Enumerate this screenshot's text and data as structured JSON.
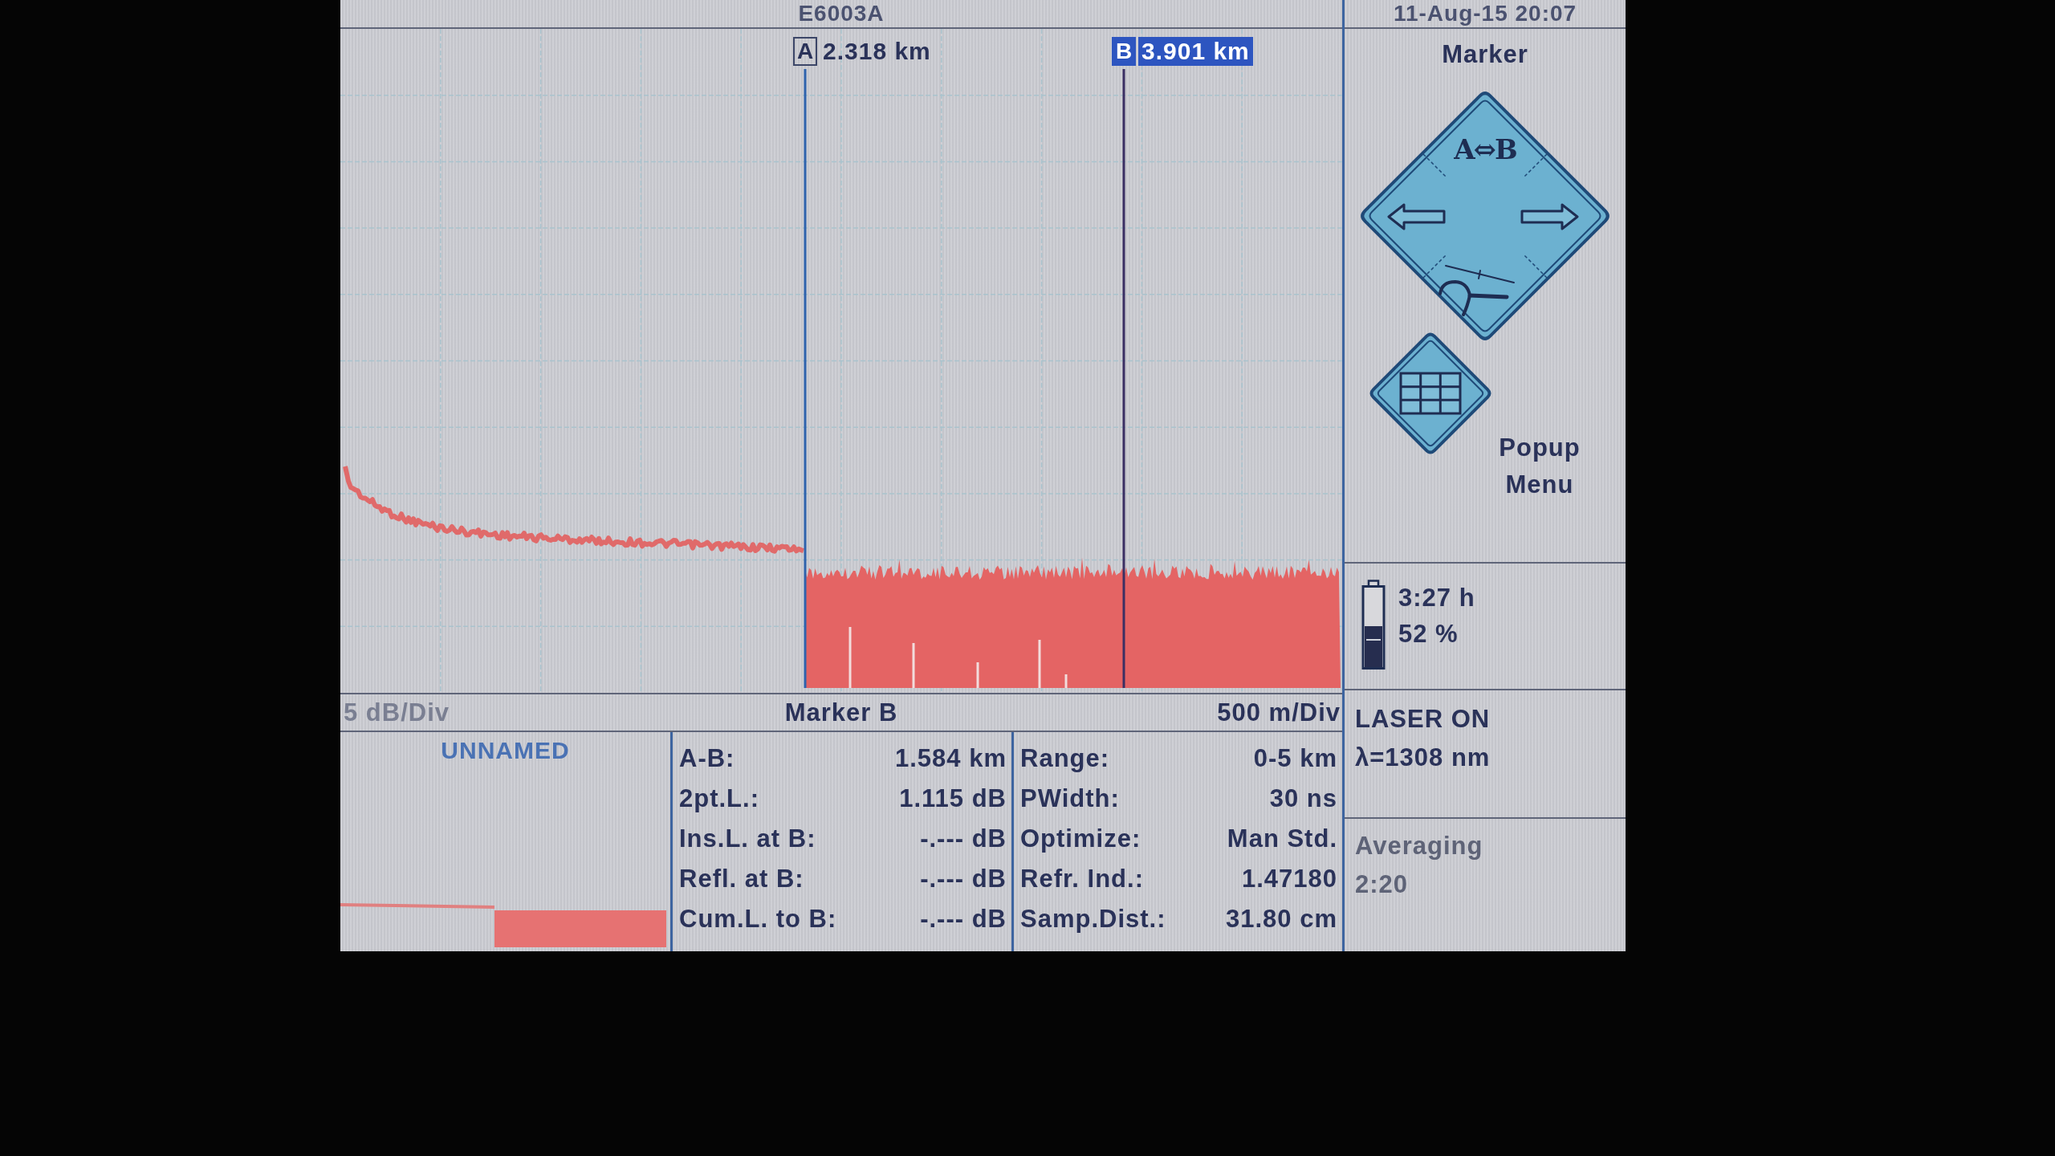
{
  "title_bar": {
    "model": "E6003A",
    "date_time": "11-Aug-15 20:07"
  },
  "trace_view": {
    "markers": [
      {
        "label": "A",
        "distance": "2.318 km",
        "selected": false
      },
      {
        "label": "B",
        "distance": "3.901 km",
        "selected": true
      }
    ]
  },
  "scale_bar": {
    "vertical_scale": "5 dB/Div",
    "active_marker": "Marker B",
    "horizontal_scale": "500 m/Div"
  },
  "overview": {
    "trace_name": "UNNAMED"
  },
  "marker_results": [
    {
      "label": "A-B:",
      "value": "1.584 km"
    },
    {
      "label": "2pt.L.:",
      "value": "1.115 dB"
    },
    {
      "label": "Ins.L. at B:",
      "value": "-.--- dB"
    },
    {
      "label": "Refl. at B:",
      "value": "-.--- dB"
    },
    {
      "label": "Cum.L. to B:",
      "value": "-.--- dB"
    }
  ],
  "settings": [
    {
      "label": "Range:",
      "value": "0-5 km"
    },
    {
      "label": "PWidth:",
      "value": "30 ns"
    },
    {
      "label": "Optimize:",
      "value": "Man Std."
    },
    {
      "label": "Refr. Ind.:",
      "value": "1.47180"
    },
    {
      "label": "Samp.Dist.:",
      "value": "31.80 cm"
    }
  ],
  "side_panel": {
    "title": "Marker",
    "swap_label": "A⇔B",
    "popup_label": "Popup Menu"
  },
  "battery": {
    "time_left": "3:27 h",
    "charge": "52 %"
  },
  "laser": {
    "status": "LASER ON",
    "wavelength": "λ=1308 nm"
  },
  "averaging": {
    "label": "Averaging",
    "time": "2:20"
  }
}
